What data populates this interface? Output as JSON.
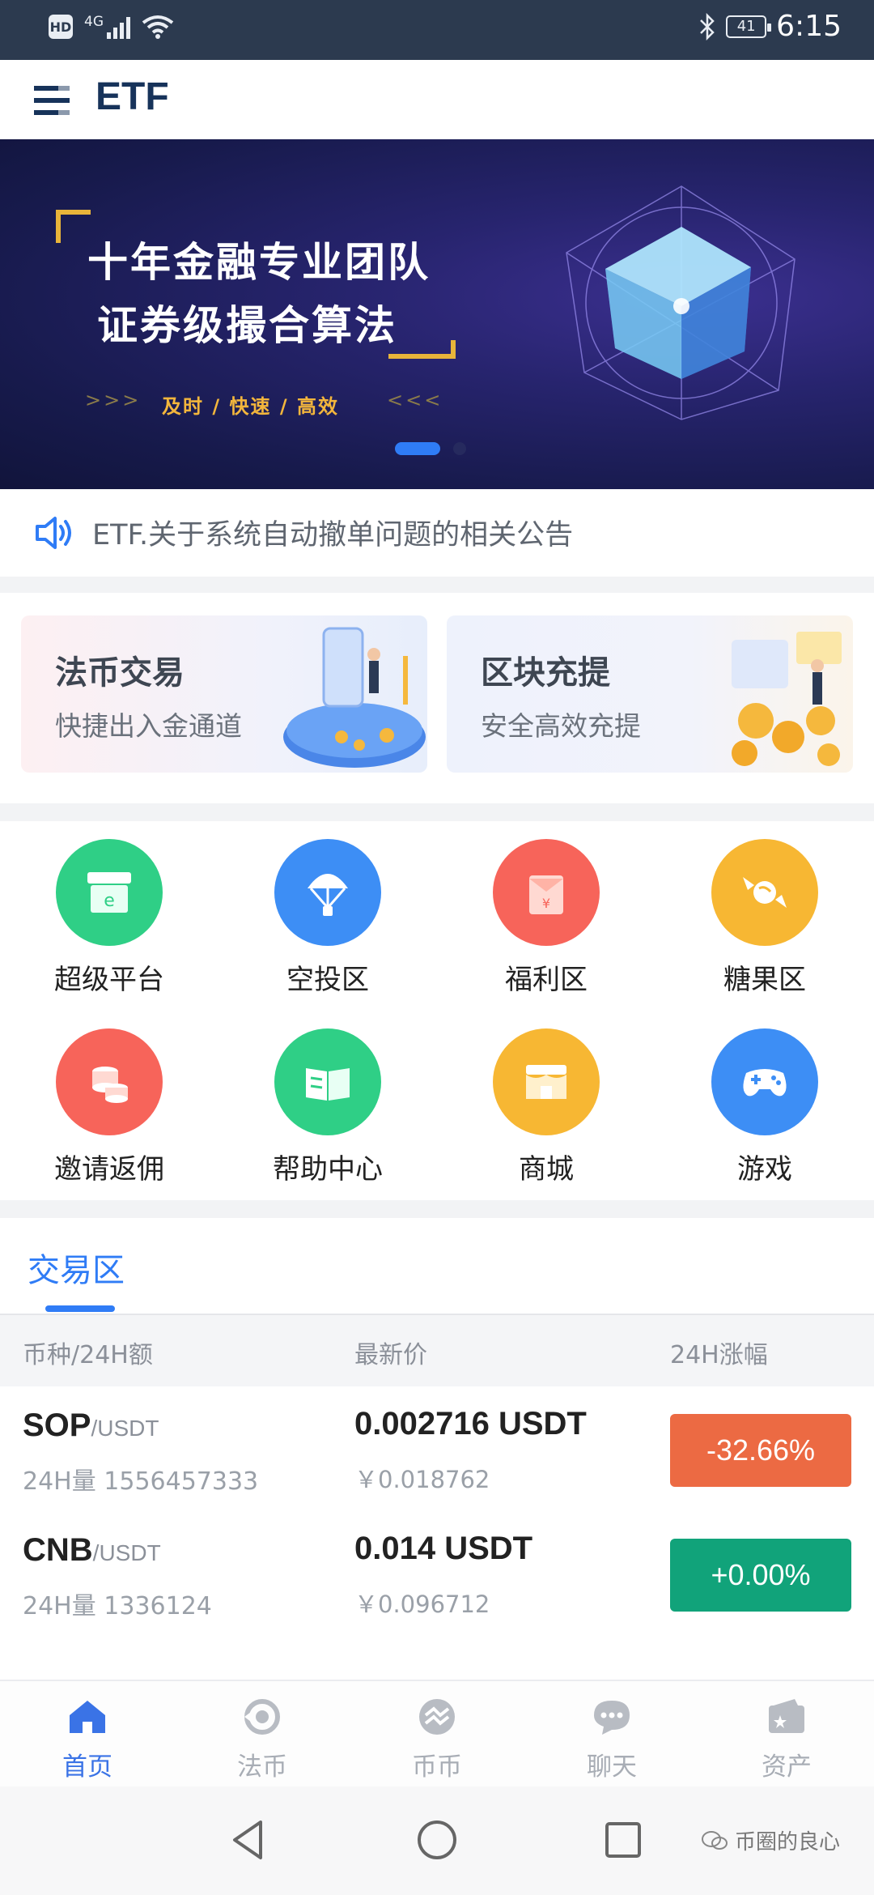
{
  "status_bar": {
    "hd": "HD",
    "network": "4G",
    "time": "6:15",
    "battery": "41"
  },
  "header": {
    "title": "ETF"
  },
  "banner": {
    "line1": "十年金融专业团队",
    "line2": "证券级撮合算法",
    "tagline": "及时 / 快速 / 高效",
    "arrows_left": ">>>",
    "arrows_right": "<<<",
    "active_slide": 1,
    "slide_count": 2
  },
  "notice": {
    "text": "ETF.关于系统自动撤单问题的相关公告"
  },
  "promo_cards": [
    {
      "title": "法币交易",
      "subtitle": "快捷出入金通道"
    },
    {
      "title": "区块充提",
      "subtitle": "安全高效充提"
    }
  ],
  "menu_items": [
    {
      "label": "超级平台",
      "icon": "store-icon",
      "color": "#2fcf86"
    },
    {
      "label": "空投区",
      "icon": "parachute-icon",
      "color": "#3d8ef5"
    },
    {
      "label": "福利区",
      "icon": "red-envelope-icon",
      "color": "#f7645a"
    },
    {
      "label": "糖果区",
      "icon": "candy-icon",
      "color": "#f7b733"
    },
    {
      "label": "邀请返佣",
      "icon": "coins-icon",
      "color": "#f7645a"
    },
    {
      "label": "帮助中心",
      "icon": "book-icon",
      "color": "#2fcf86"
    },
    {
      "label": "商城",
      "icon": "shop-icon",
      "color": "#f7b733"
    },
    {
      "label": "游戏",
      "icon": "gamepad-icon",
      "color": "#3d8ef5"
    }
  ],
  "trade": {
    "tab_label": "交易区",
    "columns": [
      "币种/24H额",
      "最新价",
      "24H涨幅"
    ],
    "rows": [
      {
        "symbol": "SOP",
        "quote": "/USDT",
        "volume": "24H量 1556457333",
        "price": "0.002716 USDT",
        "cny": "￥0.018762",
        "change": "-32.66%",
        "change_color": "#ec6a43"
      },
      {
        "symbol": "CNB",
        "quote": "/USDT",
        "volume": "24H量 1336124",
        "price": "0.014 USDT",
        "cny": "￥0.096712",
        "change": "+0.00%",
        "change_color": "#11a37a"
      }
    ]
  },
  "bottom_nav": [
    {
      "label": "首页",
      "icon": "home-icon",
      "active": true
    },
    {
      "label": "法币",
      "icon": "fiat-icon",
      "active": false
    },
    {
      "label": "币币",
      "icon": "exchange-icon",
      "active": false
    },
    {
      "label": "聊天",
      "icon": "chat-icon",
      "active": false
    },
    {
      "label": "资产",
      "icon": "wallet-icon",
      "active": false
    }
  ],
  "watermark": {
    "text": "币圈的良心"
  },
  "colors": {
    "accent": "#2f7cf6",
    "status_bar": "#2c3a4f",
    "down": "#ec6a43",
    "up": "#11a37a"
  }
}
